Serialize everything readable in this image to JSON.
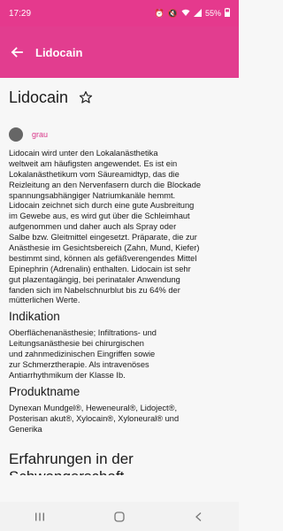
{
  "status": {
    "time": "17:29",
    "battery": "55%"
  },
  "app_bar": {
    "title": "Lidocain"
  },
  "drug": {
    "name": "Lidocain",
    "tag": "grau",
    "description": "Lidocain wird unter den Lokalanästhetika\nweltweit am häufigsten angewendet. Es ist ein\nLokalanästhetikum vom Säureamidtyp, das die\nReizleitung an den Nervenfasern durch die Blockade\nspannungsabhängiger Natriumkanäle hemmt.\nLidocain zeichnet sich durch eine gute Ausbreitung\nim Gewebe aus, es wird gut über die Schleimhaut\naufgenommen und daher auch als Spray oder\nSalbe bzw. Gleitmittel eingesetzt. Präparate, die zur\nAnästhesie im Gesichtsbereich (Zahn, Mund, Kiefer)\nbestimmt sind, können als gefäßverengendes Mittel\nEpinephrin (Adrenalin) enthalten. Lidocain ist sehr\ngut plazentagängig, bei perinataler Anwendung\nfanden sich im Nabelschnurblut bis zu 64% der\nmütterlichen Werte."
  },
  "sections": {
    "indication_title": "Indikation",
    "indication_text": "Oberflächenanästhesie; Infiltrations- und\nLeitungsanästhesie bei chirurgischen\nund zahnmedizinischen Eingriffen sowie\nzur Schmerztherapie. Als intravenöses\nAntiarrhythmikum der Klasse Ib.",
    "products_title": "Produktname",
    "products_text": "Dynexan Mundgel®, Heweneural®, Lidoject®,\nPosterisan akut®, Xylocain®, Xyloneural® und\nGenerika",
    "experience_title": "Erfahrungen in der\nSchwangerschaft"
  },
  "colors": {
    "accent": "#e23d8f",
    "tag": "#d9388a"
  }
}
